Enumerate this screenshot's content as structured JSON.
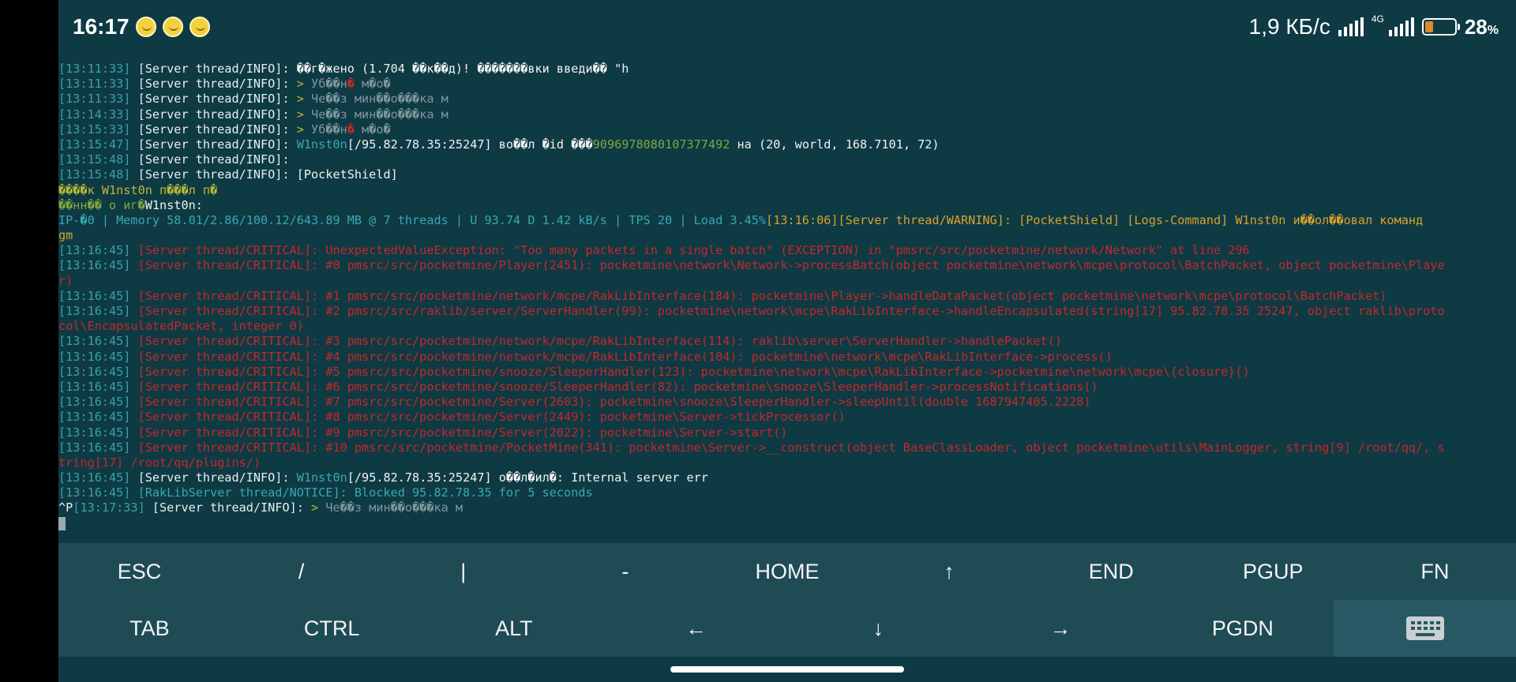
{
  "status_bar": {
    "time": "16:17",
    "net_speed": "1,9 КБ/с",
    "network_type": "4G",
    "battery_percent": "28",
    "battery_unit": "%",
    "battery_level": 0.28,
    "icons": [
      "emoji-icon",
      "emoji-icon",
      "emoji-icon",
      "signal-icon",
      "signal-4g-icon",
      "battery-icon"
    ]
  },
  "terminal": {
    "lines": [
      [
        {
          "t": "[13:11:33]",
          "c": "ts"
        },
        {
          "t": " [Server thread/INFO]: ",
          "c": "th"
        },
        {
          "t": "��г�жено (1.704 ��к��д)! �������вки введи�� \"h",
          "c": "white"
        }
      ],
      [
        {
          "t": "[13:11:33]",
          "c": "ts"
        },
        {
          "t": " [Server thread/INFO]: ",
          "c": "th"
        },
        {
          "t": "> ",
          "c": "olive"
        },
        {
          "t": "Уб��н",
          "c": "dim"
        },
        {
          "t": "�",
          "c": "crit"
        },
        {
          "t": " м�о�",
          "c": "dim"
        }
      ],
      [
        {
          "t": "[13:11:33]",
          "c": "ts"
        },
        {
          "t": " [Server thread/INFO]: ",
          "c": "th"
        },
        {
          "t": "> ",
          "c": "olive"
        },
        {
          "t": "Че��з мин��о���ка м",
          "c": "dim"
        }
      ],
      [
        {
          "t": "[13:14:33]",
          "c": "ts"
        },
        {
          "t": " [Server thread/INFO]: ",
          "c": "th"
        },
        {
          "t": "> ",
          "c": "olive"
        },
        {
          "t": "Че��з мин��о���ка м",
          "c": "dim"
        }
      ],
      [
        {
          "t": "[13:15:33]",
          "c": "ts"
        },
        {
          "t": " [Server thread/INFO]: ",
          "c": "th"
        },
        {
          "t": "> ",
          "c": "olive"
        },
        {
          "t": "Уб��н",
          "c": "dim"
        },
        {
          "t": "�",
          "c": "crit"
        },
        {
          "t": " м�о�",
          "c": "dim"
        }
      ],
      [
        {
          "t": "[13:15:47]",
          "c": "ts"
        },
        {
          "t": " [Server thread/INFO]: ",
          "c": "th"
        },
        {
          "t": "W1nst0n",
          "c": "cyan"
        },
        {
          "t": "[/95.82.78.35:25247] во��л �id ���",
          "c": "white"
        },
        {
          "t": "9096978080107377492",
          "c": "green"
        },
        {
          "t": " на (20, world, 168.7101, 72)",
          "c": "white"
        }
      ],
      [
        {
          "t": "[13:15:48]",
          "c": "ts"
        },
        {
          "t": " [Server thread/INFO]: ",
          "c": "th"
        }
      ],
      [
        {
          "t": "[13:15:48]",
          "c": "ts"
        },
        {
          "t": " [Server thread/INFO]: ",
          "c": "th"
        },
        {
          "t": "[PocketShield]",
          "c": "white"
        }
      ],
      [
        {
          "t": "����к W1nst0n п���л п�",
          "c": "olive"
        }
      ],
      [
        {
          "t": "��нн�� о иг�",
          "c": "green"
        },
        {
          "t": "W1nst0n:",
          "c": "white"
        }
      ],
      [
        {
          "t": "IP-�0 | Memory 58.01/2.86/100.12/643.89 MB @ 7 threads | U 93.74 D 1.42 kB/s | TPS 20 | Load 3.45%",
          "c": "cyan"
        },
        {
          "t": "[13:16:06]",
          "c": "warn"
        },
        {
          "t": "[Server thread/WARNING]: [PocketShield] [Logs-Command] W1nst0n и��ол��овал команд",
          "c": "warn"
        }
      ],
      [
        {
          "t": "gm",
          "c": "warn"
        }
      ],
      [
        {
          "t": "[13:16:45]",
          "c": "ts"
        },
        {
          "t": " [Server thread/CRITICAL]: UnexpectedValueException: \"Too many packets in a single batch\" (EXCEPTION) in \"pmsrc/src/pocketmine/network/Network\" at line 296",
          "c": "crit"
        }
      ],
      [
        {
          "t": "[13:16:45]",
          "c": "ts"
        },
        {
          "t": " [Server thread/CRITICAL]: #0 pmsrc/src/pocketmine/Player(2451): pocketmine\\network\\Network->processBatch(object pocketmine\\network\\mcpe\\protocol\\BatchPacket, object pocketmine\\Playe",
          "c": "crit"
        }
      ],
      [
        {
          "t": "r)",
          "c": "crit"
        }
      ],
      [
        {
          "t": "[13:16:45]",
          "c": "ts"
        },
        {
          "t": " [Server thread/CRITICAL]: #1 pmsrc/src/pocketmine/network/mcpe/RakLibInterface(184): pocketmine\\Player->handleDataPacket(object pocketmine\\network\\mcpe\\protocol\\BatchPacket)",
          "c": "crit"
        }
      ],
      [
        {
          "t": "[13:16:45]",
          "c": "ts"
        },
        {
          "t": " [Server thread/CRITICAL]: #2 pmsrc/src/raklib/server/ServerHandler(99): pocketmine\\network\\mcpe\\RakLibInterface->handleEncapsulated(string[17] 95.82.78.35 25247, object raklib\\proto",
          "c": "crit"
        }
      ],
      [
        {
          "t": "col\\EncapsulatedPacket, integer 0)",
          "c": "crit"
        }
      ],
      [
        {
          "t": "[13:16:45]",
          "c": "ts"
        },
        {
          "t": " [Server thread/CRITICAL]: #3 pmsrc/src/pocketmine/network/mcpe/RakLibInterface(114): raklib\\server\\ServerHandler->handlePacket()",
          "c": "crit"
        }
      ],
      [
        {
          "t": "[13:16:45]",
          "c": "ts"
        },
        {
          "t": " [Server thread/CRITICAL]: #4 pmsrc/src/pocketmine/network/mcpe/RakLibInterface(104): pocketmine\\network\\mcpe\\RakLibInterface->process()",
          "c": "crit"
        }
      ],
      [
        {
          "t": "[13:16:45]",
          "c": "ts"
        },
        {
          "t": " [Server thread/CRITICAL]: #5 pmsrc/src/pocketmine/snooze/SleeperHandler(123): pocketmine\\network\\mcpe\\RakLibInterface->pocketmine\\network\\mcpe\\{closure}()",
          "c": "crit"
        }
      ],
      [
        {
          "t": "[13:16:45]",
          "c": "ts"
        },
        {
          "t": " [Server thread/CRITICAL]: #6 pmsrc/src/pocketmine/snooze/SleeperHandler(82): pocketmine\\snooze\\SleeperHandler->processNotifications()",
          "c": "crit"
        }
      ],
      [
        {
          "t": "[13:16:45]",
          "c": "ts"
        },
        {
          "t": " [Server thread/CRITICAL]: #7 pmsrc/src/pocketmine/Server(2603): pocketmine\\snooze\\SleeperHandler->sleepUntil(double 1687947405.2228)",
          "c": "crit"
        }
      ],
      [
        {
          "t": "[13:16:45]",
          "c": "ts"
        },
        {
          "t": " [Server thread/CRITICAL]: #8 pmsrc/src/pocketmine/Server(2449): pocketmine\\Server->tickProcessor()",
          "c": "crit"
        }
      ],
      [
        {
          "t": "[13:16:45]",
          "c": "ts"
        },
        {
          "t": " [Server thread/CRITICAL]: #9 pmsrc/src/pocketmine/Server(2022): pocketmine\\Server->start()",
          "c": "crit"
        }
      ],
      [
        {
          "t": "[13:16:45]",
          "c": "ts"
        },
        {
          "t": " [Server thread/CRITICAL]: #10 pmsrc/src/pocketmine/PocketMine(341): pocketmine\\Server->__construct(object BaseClassLoader, object pocketmine\\utils\\MainLogger, string[9] /root/qq/, s",
          "c": "crit"
        }
      ],
      [
        {
          "t": "tring[17] /root/qq/plugins/)",
          "c": "crit"
        }
      ],
      [
        {
          "t": "[13:16:45]",
          "c": "ts"
        },
        {
          "t": " [Server thread/INFO]: ",
          "c": "th"
        },
        {
          "t": "W1nst0n",
          "c": "cyan"
        },
        {
          "t": "[/95.82.78.35:25247] о��л�ил�: Internal server err",
          "c": "white"
        }
      ],
      [
        {
          "t": "[13:16:45]",
          "c": "ts"
        },
        {
          "t": " [RakLibServer thread/NOTICE]: Blocked 95.82.78.35 for 5 seconds",
          "c": "cyan"
        }
      ],
      [
        {
          "t": "^P",
          "c": "white"
        },
        {
          "t": "[13:17:33]",
          "c": "ts"
        },
        {
          "t": " [Server thread/INFO]: ",
          "c": "th"
        },
        {
          "t": "> ",
          "c": "olive"
        },
        {
          "t": "Че��з мин��о���ка м",
          "c": "dim"
        }
      ]
    ]
  },
  "extra_keys": {
    "row1": [
      "ESC",
      "/",
      "|",
      "-",
      "HOME",
      "↑",
      "END",
      "PGUP",
      "FN"
    ],
    "row2": [
      "TAB",
      "CTRL",
      "ALT",
      "←",
      "↓",
      "→",
      "PGDN"
    ],
    "keyboard_toggle_icon": "keyboard-icon"
  }
}
